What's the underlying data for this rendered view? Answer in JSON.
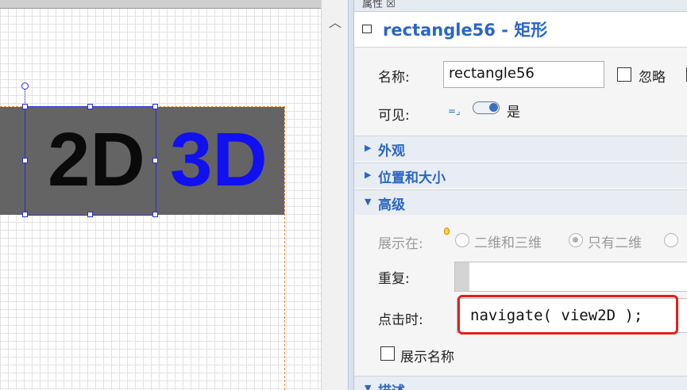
{
  "canvas": {
    "label_2d": "2D",
    "label_3d": "3D",
    "colors": {
      "rect_fill": "#646464",
      "label_2d": "#0a0a0a",
      "label_3d": "#1010f0",
      "selection": "#2b2bd4",
      "page_border": "#e08a33"
    }
  },
  "props": {
    "tab_label": "属性 ☒",
    "object_title": "rectangle56 - 矩形",
    "name_label": "名称:",
    "name_value": "rectangle56",
    "ignore_label": "忽略",
    "visible_label": "可见:",
    "visible_value": "是",
    "sections": {
      "appearance": "外观",
      "position": "位置和大小",
      "advanced": "高级",
      "description": "描述"
    },
    "show_in_label": "展示在:",
    "show_options": [
      "二维和三维",
      "只有二维",
      ""
    ],
    "show_selected": "只有二维",
    "repeat_label": "重复:",
    "on_click_label": "点击时:",
    "on_click_code": "navigate( view2D );",
    "show_name_label": "展示名称",
    "accent_color": "#2a66c2",
    "highlight_color": "#e4201b"
  }
}
